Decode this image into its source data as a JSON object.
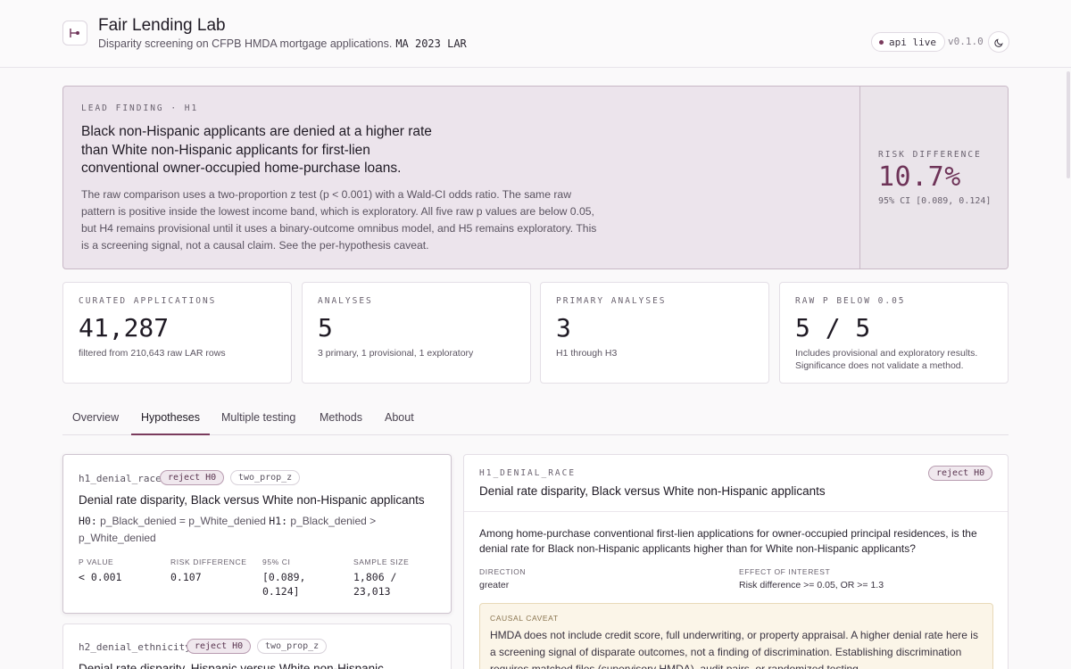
{
  "header": {
    "title": "Fair Lending Lab",
    "subtitle": "Disparity screening on CFPB HMDA mortgage applications.",
    "dataset": "MA 2023 LAR",
    "api_status": "api live",
    "version": "v0.1.0",
    "logo_icon": "bar-dot-icon",
    "theme_icon": "moon-icon"
  },
  "lead": {
    "eyebrow": "LEAD FINDING · H1",
    "title": "Black non-Hispanic applicants are denied at a higher rate than White non-Hispanic applicants for first-lien conventional owner-occupied home-purchase loans.",
    "body": "The raw comparison uses a two-proportion z test (p < 0.001) with a Wald-CI odds ratio. The same raw pattern is positive inside the lowest income band, which is exploratory. All five raw p values are below 0.05, but H4 remains provisional until it uses a binary-outcome omnibus model, and H5 remains exploratory. This is a screening signal, not a causal claim. See the per-hypothesis caveat.",
    "risk_label": "RISK DIFFERENCE",
    "risk_value": "10.7%",
    "risk_ci": "95% CI [0.089, 0.124]"
  },
  "stats": [
    {
      "label": "CURATED APPLICATIONS",
      "value": "41,287",
      "note": "filtered from 210,643 raw LAR rows"
    },
    {
      "label": "ANALYSES",
      "value": "5",
      "note": "3 primary, 1 provisional, 1 exploratory"
    },
    {
      "label": "PRIMARY ANALYSES",
      "value": "3",
      "note": "H1 through H3"
    },
    {
      "label": "RAW P BELOW 0.05",
      "value": "5 / 5",
      "note": "Includes provisional and exploratory results. Significance does not validate a method."
    }
  ],
  "tabs": [
    "Overview",
    "Hypotheses",
    "Multiple testing",
    "Methods",
    "About"
  ],
  "active_tab": "Hypotheses",
  "hypotheses": [
    {
      "id": "h1_denial_race",
      "decision": "reject H0",
      "test": "two_prop_z",
      "title": "Denial rate disparity, Black versus White non-Hispanic applicants",
      "h0_label": "H0:",
      "h0": "p_Black_denied = p_White_denied",
      "h1_label": "H1:",
      "h1": "p_Black_denied > p_White_denied",
      "metrics": [
        {
          "label": "P VALUE",
          "value": "< 0.001"
        },
        {
          "label": "RISK DIFFERENCE",
          "value": "0.107"
        },
        {
          "label": "95% CI",
          "value": "[0.089, 0.124]"
        },
        {
          "label": "SAMPLE SIZE",
          "value": "1,806 / 23,013"
        }
      ]
    },
    {
      "id": "h2_denial_ethnicity",
      "decision": "reject H0",
      "test": "two_prop_z",
      "title": "Denial rate disparity, Hispanic versus White non-Hispanic"
    }
  ],
  "detail": {
    "eyebrow": "H1_DENIAL_RACE",
    "decision": "reject H0",
    "title": "Denial rate disparity, Black versus White non-Hispanic applicants",
    "question": "Among home-purchase conventional first-lien applications for owner-occupied principal residences, is the denial rate for Black non-Hispanic applicants higher than for White non-Hispanic applicants?",
    "direction_label": "DIRECTION",
    "direction": "greater",
    "effect_label": "EFFECT OF INTEREST",
    "effect": "Risk difference >= 0.05, OR >= 1.3",
    "caveat_label": "CAUSAL CAVEAT",
    "caveat": "HMDA does not include credit score, full underwriting, or property appraisal. A higher denial rate here is a screening signal of disparate outcomes, not a finding of discrimination. Establishing discrimination requires matched files (supervisory HMDA), audit pairs, or randomized testing."
  }
}
